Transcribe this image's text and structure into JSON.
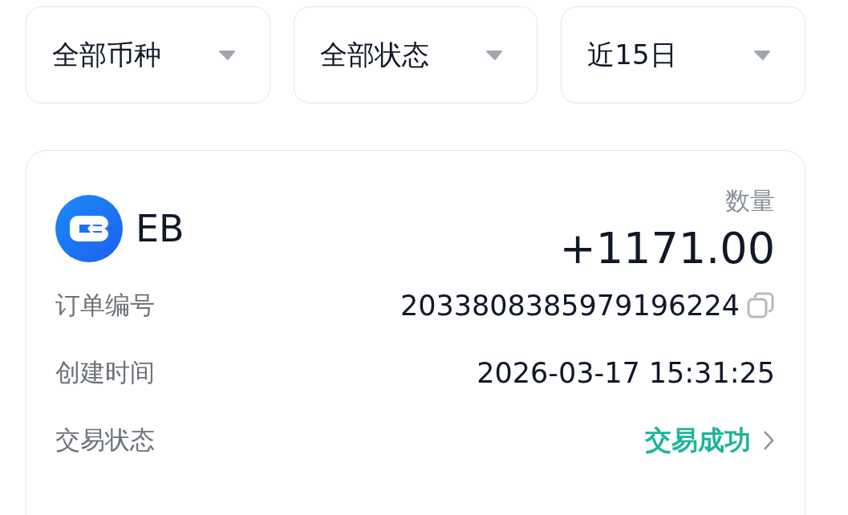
{
  "filters": [
    {
      "label": "全部币种"
    },
    {
      "label": "全部状态"
    },
    {
      "label": "近15日"
    }
  ],
  "order": {
    "coin": "EB",
    "quantity_label": "数量",
    "quantity": "+1171.00",
    "fields": [
      {
        "kind": "copyable",
        "label": "订单编号",
        "value": "2033808385979196224"
      },
      {
        "kind": "plain",
        "label": "创建时间",
        "value": "2026-03-17 15:31:25"
      },
      {
        "kind": "status",
        "label": "交易状态",
        "value": "交易成功"
      }
    ]
  }
}
